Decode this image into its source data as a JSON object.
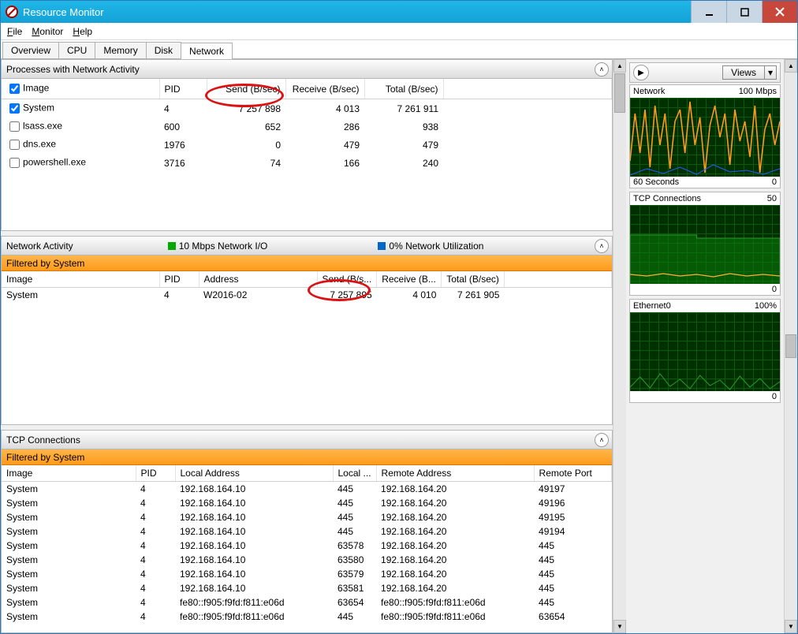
{
  "window": {
    "title": "Resource Monitor"
  },
  "menu": {
    "file": "File",
    "monitor": "Monitor",
    "help": "Help"
  },
  "tabs": {
    "overview": "Overview",
    "cpu": "CPU",
    "memory": "Memory",
    "disk": "Disk",
    "network": "Network"
  },
  "processes": {
    "title": "Processes with Network Activity",
    "headers": {
      "image": "Image",
      "pid": "PID",
      "send": "Send (B/sec)",
      "recv": "Receive (B/sec)",
      "total": "Total (B/sec)"
    },
    "rows": [
      {
        "checked": true,
        "image": "System",
        "pid": "4",
        "send": "7 257 898",
        "recv": "4 013",
        "total": "7 261 911"
      },
      {
        "checked": false,
        "image": "lsass.exe",
        "pid": "600",
        "send": "652",
        "recv": "286",
        "total": "938"
      },
      {
        "checked": false,
        "image": "dns.exe",
        "pid": "1976",
        "send": "0",
        "recv": "479",
        "total": "479"
      },
      {
        "checked": false,
        "image": "powershell.exe",
        "pid": "3716",
        "send": "74",
        "recv": "166",
        "total": "240"
      }
    ]
  },
  "activity": {
    "title": "Network Activity",
    "legend1": "10 Mbps Network I/O",
    "legend2": "0% Network Utilization",
    "filtered": "Filtered by System",
    "headers": {
      "image": "Image",
      "pid": "PID",
      "address": "Address",
      "send": "Send (B/s...",
      "recv": "Receive (B...",
      "total": "Total (B/sec)"
    },
    "rows": [
      {
        "image": "System",
        "pid": "4",
        "address": "W2016-02",
        "send": "7 257 895",
        "recv": "4 010",
        "total": "7 261 905"
      }
    ]
  },
  "tcp": {
    "title": "TCP Connections",
    "filtered": "Filtered by System",
    "headers": {
      "image": "Image",
      "pid": "PID",
      "laddr": "Local Address",
      "lport": "Local ...",
      "raddr": "Remote Address",
      "rport": "Remote Port"
    },
    "rows": [
      {
        "image": "System",
        "pid": "4",
        "laddr": "192.168.164.10",
        "lport": "445",
        "raddr": "192.168.164.20",
        "rport": "49197"
      },
      {
        "image": "System",
        "pid": "4",
        "laddr": "192.168.164.10",
        "lport": "445",
        "raddr": "192.168.164.20",
        "rport": "49196"
      },
      {
        "image": "System",
        "pid": "4",
        "laddr": "192.168.164.10",
        "lport": "445",
        "raddr": "192.168.164.20",
        "rport": "49195"
      },
      {
        "image": "System",
        "pid": "4",
        "laddr": "192.168.164.10",
        "lport": "445",
        "raddr": "192.168.164.20",
        "rport": "49194"
      },
      {
        "image": "System",
        "pid": "4",
        "laddr": "192.168.164.10",
        "lport": "63578",
        "raddr": "192.168.164.20",
        "rport": "445"
      },
      {
        "image": "System",
        "pid": "4",
        "laddr": "192.168.164.10",
        "lport": "63580",
        "raddr": "192.168.164.20",
        "rport": "445"
      },
      {
        "image": "System",
        "pid": "4",
        "laddr": "192.168.164.10",
        "lport": "63579",
        "raddr": "192.168.164.20",
        "rport": "445"
      },
      {
        "image": "System",
        "pid": "4",
        "laddr": "192.168.164.10",
        "lport": "63581",
        "raddr": "192.168.164.20",
        "rport": "445"
      },
      {
        "image": "System",
        "pid": "4",
        "laddr": "fe80::f905:f9fd:f811:e06d",
        "lport": "63654",
        "raddr": "fe80::f905:f9fd:f811:e06d",
        "rport": "445"
      },
      {
        "image": "System",
        "pid": "4",
        "laddr": "fe80::f905:f9fd:f811:e06d",
        "lport": "445",
        "raddr": "fe80::f905:f9fd:f811:e06d",
        "rport": "63654"
      }
    ]
  },
  "side": {
    "views": "Views",
    "graphs": [
      {
        "title": "Network",
        "right": "100 Mbps",
        "footL": "60 Seconds",
        "footR": "0"
      },
      {
        "title": "TCP Connections",
        "right": "50",
        "footL": "",
        "footR": "0"
      },
      {
        "title": "Ethernet0",
        "right": "100%",
        "footL": "",
        "footR": "0"
      }
    ]
  }
}
